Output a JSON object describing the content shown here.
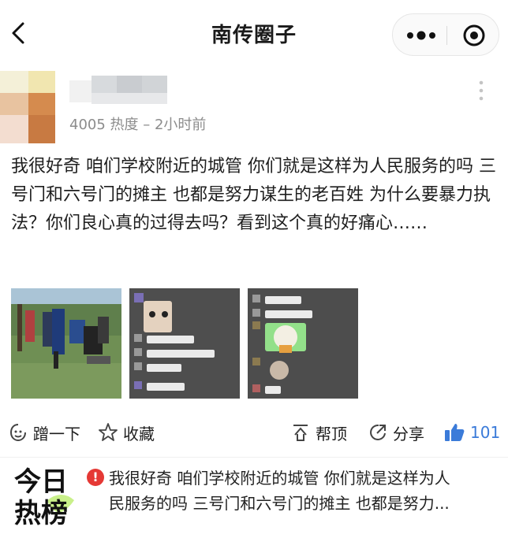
{
  "header": {
    "title": "南传圈子",
    "back_icon": "chevron-left-icon",
    "more_icon": "more-dots-icon",
    "close_icon": "target-circle-icon"
  },
  "post": {
    "meta": "4005 热度 – 2小时前",
    "content": "我很好奇 咱们学校附近的城管 你们就是这样为人民服务的吗 三号门和六号门的摊主 也都是努力谋生的老百姓 为什么要暴力执法？你们良心真的过得去吗？看到这个真的好痛心……"
  },
  "actions": {
    "nudge": "蹭一下",
    "favorite": "收藏",
    "pin": "帮顶",
    "share": "分享",
    "likes": "101"
  },
  "hot_list": {
    "logo_line1": "今日",
    "logo_line2": "热榜",
    "line1": "我很好奇 咱们学校附近的城管 你们就是这样为人",
    "line2": "民服务的吗 三号门和六号门的摊主 也都是努力..."
  },
  "colors": {
    "accent": "#3b7bd9",
    "hot_icon": "#e53935",
    "meta_gray": "#8c8c8c"
  }
}
